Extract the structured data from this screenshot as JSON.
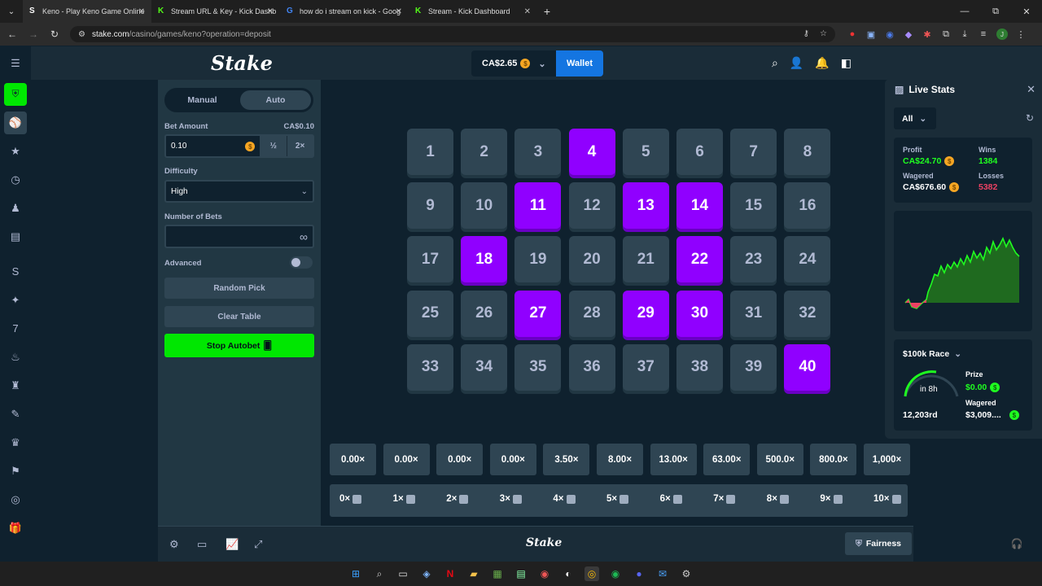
{
  "browser": {
    "tabs": [
      {
        "title": "Keno - Play Keno Game Online",
        "icon": "stake-s-icon"
      },
      {
        "title": "Stream URL & Key - Kick Dashb",
        "icon": "kick-icon"
      },
      {
        "title": "how do i stream on kick - Goog",
        "icon": "google-icon"
      },
      {
        "title": "Stream - Kick Dashboard",
        "icon": "kick-icon"
      }
    ],
    "url_domain": "stake.com",
    "url_path": "/casino/games/keno?operation=deposit",
    "window_controls": [
      "—",
      "⧉",
      "✕"
    ]
  },
  "header": {
    "logo": "Stake",
    "balance": "CA$2.65",
    "wallet_label": "Wallet"
  },
  "bet_panel": {
    "modes": [
      "Manual",
      "Auto"
    ],
    "active_mode": "Auto",
    "bet_amount_label": "Bet Amount",
    "bet_amount_value_display": "CA$0.10",
    "bet_amount_input": "0.10",
    "half_label": "½",
    "double_label": "2×",
    "difficulty_label": "Difficulty",
    "difficulty_value": "High",
    "bets_label": "Number of Bets",
    "bets_value": "",
    "infinity": "∞",
    "advanced_label": "Advanced",
    "random_pick_label": "Random Pick",
    "clear_table_label": "Clear Table",
    "stop_autobet_label": "Stop Autobet"
  },
  "board": {
    "numbers": [
      "1",
      "2",
      "3",
      "4",
      "5",
      "6",
      "7",
      "8",
      "9",
      "10",
      "11",
      "12",
      "13",
      "14",
      "15",
      "16",
      "17",
      "18",
      "19",
      "20",
      "21",
      "22",
      "23",
      "24",
      "25",
      "26",
      "27",
      "28",
      "29",
      "30",
      "31",
      "32",
      "33",
      "34",
      "35",
      "36",
      "37",
      "38",
      "39",
      "40"
    ],
    "selected": [
      "4",
      "11",
      "13",
      "14",
      "18",
      "22",
      "27",
      "29",
      "30",
      "40"
    ]
  },
  "multipliers": [
    "0.00×",
    "0.00×",
    "0.00×",
    "0.00×",
    "3.50×",
    "8.00×",
    "13.00×",
    "63.00×",
    "500.0×",
    "800.0×",
    "1,000×"
  ],
  "hits": [
    "0×",
    "1×",
    "2×",
    "3×",
    "4×",
    "5×",
    "6×",
    "7×",
    "8×",
    "9×",
    "10×"
  ],
  "footer": {
    "logo": "Stake",
    "fairness_label": "Fairness"
  },
  "live_stats": {
    "title": "Live Stats",
    "filter": "All",
    "profit_label": "Profit",
    "profit_value": "CA$24.70",
    "wins_label": "Wins",
    "wins_value": "1384",
    "wagered_label": "Wagered",
    "wagered_value": "CA$676.60",
    "losses_label": "Losses",
    "losses_value": "5382",
    "colors": {
      "profit": "#1fff20",
      "loss": "#ed4163"
    }
  },
  "race": {
    "title": "$100k Race",
    "time_left": "in 8h",
    "rank": "12,203rd",
    "prize_label": "Prize",
    "prize_value": "$0.00",
    "wagered_label": "Wagered",
    "wagered_value": "$3,009...."
  },
  "taskbar_icons": [
    "windows-icon",
    "search-icon",
    "file-explorer-icon",
    "copilot-icon",
    "netflix-icon",
    "folder-icon",
    "minecraft-icon",
    "calculator-icon",
    "app-icon",
    "capcut-icon",
    "chrome-icon",
    "spotify-icon",
    "discord-icon",
    "mail-icon",
    "steam-icon"
  ]
}
